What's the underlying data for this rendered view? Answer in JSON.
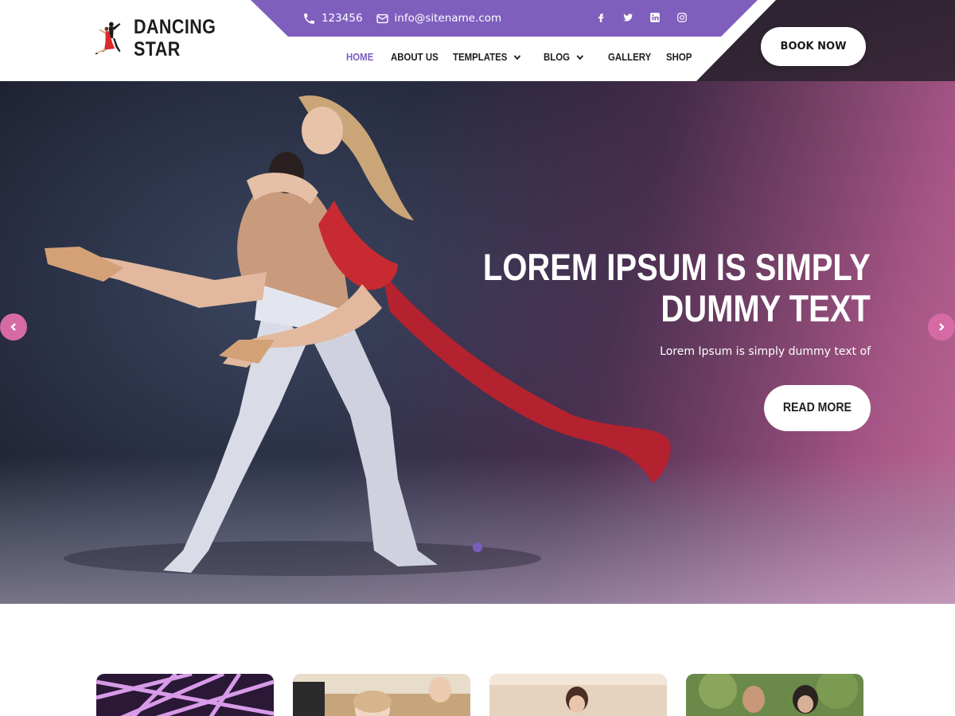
{
  "brand": {
    "line1": "DANCING",
    "line2": "STAR"
  },
  "contact": {
    "phone": "123456",
    "email": "info@sitename.com"
  },
  "social": [
    "facebook-icon",
    "twitter-icon",
    "linkedin-icon",
    "instagram-icon"
  ],
  "nav": {
    "items": [
      {
        "label": "HOME",
        "active": true
      },
      {
        "label": "ABOUT US"
      },
      {
        "label": "TEMPLATES",
        "dropdown": true
      },
      {
        "label": "BLOG",
        "dropdown": true
      },
      {
        "label": "GALLERY"
      },
      {
        "label": "SHOP"
      }
    ]
  },
  "cta": {
    "book_now": "BOOK NOW"
  },
  "hero": {
    "title_line1": "LOREM IPSUM IS SIMPLY",
    "title_line2": "DUMMY TEXT",
    "subtitle": "Lorem Ipsum is simply dummy text of",
    "button": "READ MORE",
    "slide_count": 1,
    "active_slide": 1
  },
  "colors": {
    "accent_purple": "#7c5cbf",
    "accent_pink": "#d56aa5",
    "text_dark": "#1e1e1e"
  }
}
